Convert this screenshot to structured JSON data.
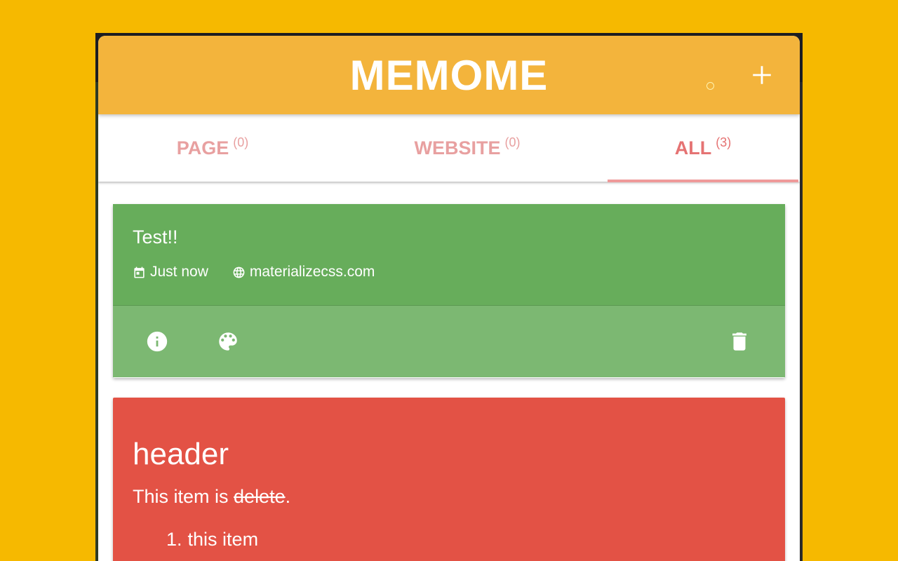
{
  "app": {
    "title": "MEMOME",
    "add_label": "+"
  },
  "tabs": [
    {
      "label": "PAGE",
      "count": "(0)"
    },
    {
      "label": "WEBSITE",
      "count": "(0)"
    },
    {
      "label": "ALL",
      "count": "(3)"
    }
  ],
  "active_tab": "ALL",
  "memos": [
    {
      "text": "Test!!",
      "time": "Just now",
      "site": "materializecss.com",
      "color": "#67ad5b",
      "actions": [
        "info-icon",
        "palette-icon",
        "delete-icon"
      ]
    },
    {
      "header": "header",
      "line_prefix": "This item is ",
      "line_struck": "delete",
      "line_suffix": ".",
      "list_number": "1.",
      "list_item": "this item",
      "color": "#e35245"
    }
  ],
  "colors": {
    "background": "#f6b900",
    "header": "#f3b43c",
    "tab_text": "#e8a0a0",
    "tab_active": "#e57373",
    "indicator": "#ef9a9a"
  }
}
